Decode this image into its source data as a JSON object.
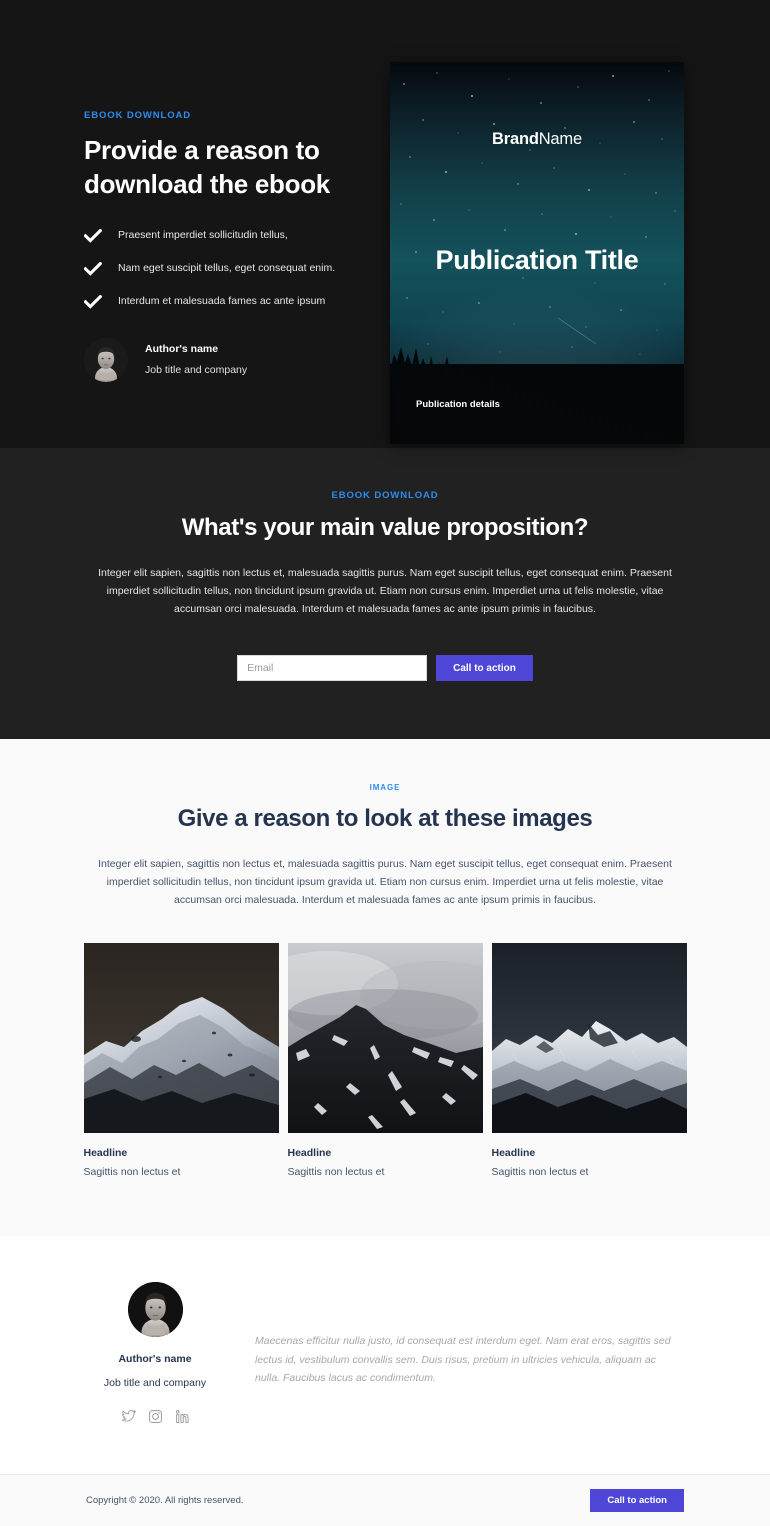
{
  "hero": {
    "eyebrow": "EBOOK DOWNLOAD",
    "title": "Provide a reason to download the ebook",
    "bullets": [
      "Praesent imperdiet sollicitudin tellus,",
      "Nam eget suscipit tellus, eget consequat enim.",
      "Interdum et malesuada fames ac ante ipsum"
    ],
    "author": {
      "name": "Author's name",
      "job": "Job title and company"
    },
    "cover": {
      "brand_bold": "Brand",
      "brand_light": "Name",
      "title": "Publication Title",
      "details": "Publication details"
    }
  },
  "valueprop": {
    "eyebrow": "EBOOK DOWNLOAD",
    "title": "What's your main value proposition?",
    "body": "Integer elit sapien, sagittis non lectus et, malesuada sagittis purus. Nam eget suscipit tellus, eget consequat enim. Praesent imperdiet sollicitudin tellus, non tincidunt ipsum gravida ut. Etiam non cursus enim. Imperdiet urna ut felis molestie, vitae accumsan orci malesuada. Interdum et malesuada fames ac ante ipsum primis in faucibus.",
    "email_placeholder": "Email",
    "email_value": "",
    "cta_label": "Call to action"
  },
  "images": {
    "eyebrow": "IMAGE",
    "title": "Give a reason to look at these images",
    "body": "Integer elit sapien, sagittis non lectus et, malesuada sagittis purus. Nam eget suscipit tellus, eget consequat enim. Praesent imperdiet sollicitudin tellus, non tincidunt ipsum gravida ut. Etiam non cursus enim. Imperdiet urna ut felis molestie, vitae accumsan orci malesuada. Interdum et malesuada fames ac ante ipsum primis in faucibus.",
    "cards": [
      {
        "headline": "Headline",
        "subtitle": "Sagittis non lectus et",
        "image": "dark-snowy-mountain-at-dusk"
      },
      {
        "headline": "Headline",
        "subtitle": "Sagittis non lectus et",
        "image": "grey-cloudy-mountain-peak"
      },
      {
        "headline": "Headline",
        "subtitle": "Sagittis non lectus et",
        "image": "blue-snowy-mountain-range"
      }
    ]
  },
  "testimonial": {
    "name": "Author's name",
    "job": "Job title and company",
    "quote": "Maecenas efficitur nulla justo, id consequat est interdum eget. Nam erat eros, sagittis sed lectus id, vestibulum convallis sem. Duis risus, pretium in ultricies vehicula, aliquam ac nulla. Faucibus lacus ac condimentum.",
    "socials": [
      {
        "name": "twitter-icon",
        "label": "Twitter"
      },
      {
        "name": "instagram-icon",
        "label": "Instagram"
      },
      {
        "name": "linkedin-icon",
        "label": "LinkedIn"
      }
    ]
  },
  "footer": {
    "copyright": "Copyright © 2020. All rights reserved.",
    "cta_label": "Call to action"
  },
  "colors": {
    "accent_blue": "#2d8cf0",
    "purple": "#4e46d6",
    "hero_bg": "#151515",
    "valueprop_bg": "#212121",
    "images_bg": "#fafafa",
    "heading_navy": "#25354f"
  }
}
